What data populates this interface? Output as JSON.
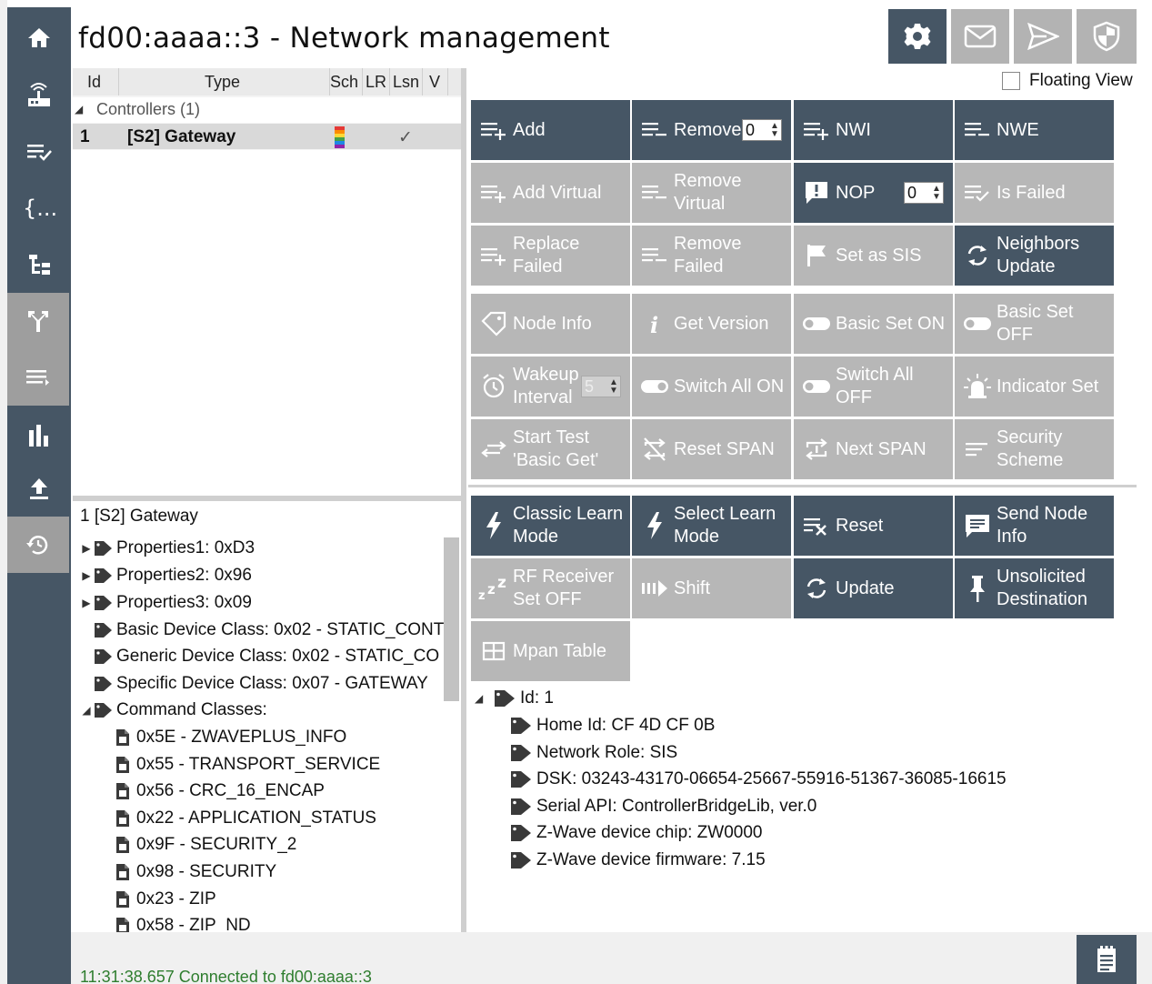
{
  "window": {
    "title": "fd00:aaaa::3 - Network management"
  },
  "sidebar": {
    "items": [
      {
        "name": "home-icon"
      },
      {
        "name": "router-icon"
      },
      {
        "name": "list-check-icon"
      },
      {
        "name": "braces-icon"
      },
      {
        "name": "tree-icon"
      },
      {
        "name": "network-icon",
        "active": true
      },
      {
        "name": "list-arrow-icon",
        "active": true
      },
      {
        "name": "bar-chart-icon"
      },
      {
        "name": "upload-icon"
      },
      {
        "name": "restore-icon",
        "active": true
      }
    ]
  },
  "toolbar": {
    "buttons": [
      {
        "name": "settings-icon",
        "enabled": true
      },
      {
        "name": "mail-icon",
        "enabled": false
      },
      {
        "name": "send-icon",
        "enabled": false
      },
      {
        "name": "shield-icon",
        "enabled": false
      }
    ]
  },
  "node_list": {
    "columns": [
      "Id",
      "Type",
      "Sch",
      "LR",
      "Lsn",
      "V"
    ],
    "group_label": "Controllers (1)",
    "rows": [
      {
        "id": "1",
        "type": "[S2] Gateway",
        "lsn": "✓"
      }
    ]
  },
  "node_tree": {
    "title": "1 [S2] Gateway",
    "items": [
      {
        "label": "Properties1: 0xD3",
        "expander": "▶"
      },
      {
        "label": "Properties2: 0x96",
        "expander": "▶"
      },
      {
        "label": "Properties3: 0x09",
        "expander": "▶"
      },
      {
        "label": "Basic Device Class: 0x02 - STATIC_CONT"
      },
      {
        "label": "Generic Device Class: 0x02 - STATIC_CO"
      },
      {
        "label": "Specific Device Class: 0x07 - GATEWAY"
      },
      {
        "label": "Command Classes:",
        "expander": "◢"
      }
    ],
    "command_classes": [
      "0x5E - ZWAVEPLUS_INFO",
      "0x55 - TRANSPORT_SERVICE",
      "0x56 - CRC_16_ENCAP",
      "0x22 - APPLICATION_STATUS",
      "0x9F - SECURITY_2",
      "0x98 - SECURITY",
      "0x23 - ZIP",
      "0x58 - ZIP_ND"
    ]
  },
  "floating_view": {
    "label": "Floating View",
    "checked": false
  },
  "commands": {
    "add": "Add",
    "remove": "Remove",
    "remove_value": "0",
    "nwi": "NWI",
    "nwe": "NWE",
    "add_virtual": "Add Virtual",
    "remove_virtual_1": "Remove",
    "remove_virtual_2": "Virtual",
    "nop": "NOP",
    "nop_value": "0",
    "is_failed": "Is Failed",
    "replace_failed": "Replace Failed",
    "remove_failed": "Remove Failed",
    "set_as_sis": "Set as SIS",
    "neighbors_update_1": "Neighbors",
    "neighbors_update_2": "Update",
    "node_info": "Node Info",
    "get_version": "Get Version",
    "basic_set_on": "Basic Set ON",
    "basic_set_off": "Basic Set OFF",
    "wakeup_1": "Wakeup",
    "wakeup_2": "Interval",
    "wakeup_value": "5",
    "switch_all_on": "Switch All ON",
    "switch_all_off": "Switch All OFF",
    "indicator_set": "Indicator Set",
    "start_test_1": "Start Test",
    "start_test_2": "'Basic Get'",
    "reset_span": "Reset SPAN",
    "next_span": "Next SPAN",
    "security_scheme_1": "Security",
    "security_scheme_2": "Scheme",
    "classic_learn_1": "Classic Learn",
    "classic_learn_2": "Mode",
    "select_learn_1": "Select Learn",
    "select_learn_2": "Mode",
    "reset": "Reset",
    "send_node_info_1": "Send Node",
    "send_node_info_2": "Info",
    "rf_receiver_1": "RF Receiver",
    "rf_receiver_2": "Set OFF",
    "shift": "Shift",
    "update": "Update",
    "unsolicited_1": "Unsolicited",
    "unsolicited_2": "Destination",
    "mpan_table": "Mpan Table"
  },
  "info": {
    "root": "Id: 1",
    "items": [
      "Home Id: CF 4D CF 0B",
      "Network Role: SIS",
      "DSK: 03243-43170-06654-25667-55916-51367-36085-16615",
      "Serial API: ControllerBridgeLib, ver.0",
      "Z-Wave device chip: ZW0000",
      "Z-Wave device firmware: 7.15"
    ]
  },
  "status": {
    "text": "11:31:38.657 Connected to fd00:aaaa::3"
  },
  "colors": {
    "dark": "#465665",
    "disabled": "#b7b7b7",
    "status_green": "#2e7d2e"
  }
}
